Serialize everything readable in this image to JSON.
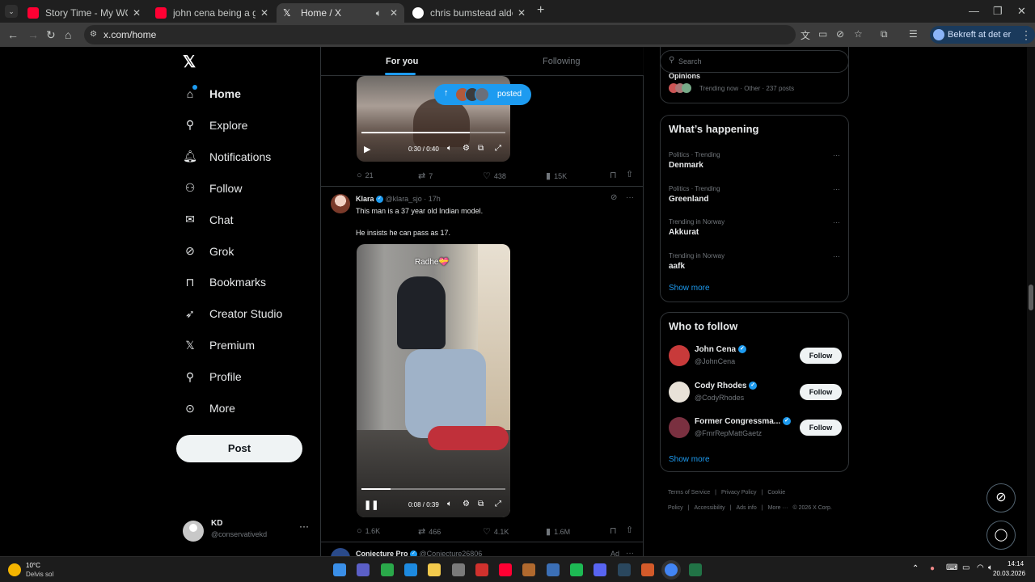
{
  "browser": {
    "tabs": [
      {
        "title": "Story Time - My WORST CYCLE",
        "favicon_color": "#ff0033"
      },
      {
        "title": "john cena being a girl - YouTube",
        "favicon_color": "#ff0033"
      },
      {
        "title": "Home / X",
        "favicon_color": "#ffffff",
        "active": true
      },
      {
        "title": "chris bumstead alder - Google",
        "favicon_color": "#4285f4"
      }
    ],
    "url": "x.com/home",
    "profile_chip": "Bekreft at det er deg"
  },
  "sidebar": {
    "items": [
      {
        "label": "Home",
        "icon": "home-icon"
      },
      {
        "label": "Explore",
        "icon": "search-icon"
      },
      {
        "label": "Notifications",
        "icon": "bell-icon"
      },
      {
        "label": "Follow",
        "icon": "person-add-icon"
      },
      {
        "label": "Chat",
        "icon": "mail-icon"
      },
      {
        "label": "Grok",
        "icon": "grok-icon"
      },
      {
        "label": "Bookmarks",
        "icon": "bookmark-icon"
      },
      {
        "label": "Creator Studio",
        "icon": "rocket-icon"
      },
      {
        "label": "Premium",
        "icon": "x-logo-icon"
      },
      {
        "label": "Profile",
        "icon": "person-icon"
      },
      {
        "label": "More",
        "icon": "more-circle-icon"
      }
    ],
    "post_label": "Post",
    "account": {
      "name": "KD",
      "handle": "@conservativekd"
    }
  },
  "feed": {
    "tabs": [
      "For you",
      "Following"
    ],
    "new_posts_pill": "posted",
    "post1": {
      "video_time": "0:30 / 0:40",
      "video_progress": 0.75,
      "replies": "21",
      "reposts": "7",
      "likes": "438",
      "views": "15K"
    },
    "post2": {
      "author": "Klara",
      "handle": "@klara_sjo",
      "time": "17h",
      "text1": "This man is a 37 year old Indian model.",
      "text2": "He insists he can pass as 17.",
      "video_caption": "Radhe💝",
      "video_time": "0:08 / 0:39",
      "video_progress": 0.2,
      "replies": "1.6K",
      "reposts": "466",
      "likes": "4.1K",
      "views": "1.6M"
    },
    "post3": {
      "author": "Conjecture Pro",
      "handle": "@Conjecture26806",
      "ad": "Ad"
    }
  },
  "right": {
    "search_placeholder": "Search",
    "top_trend": {
      "name": "Opinions",
      "meta": "Trending now · Other · 237 posts"
    },
    "whats_happening": {
      "title": "What’s happening",
      "trends": [
        {
          "category": "Politics · Trending",
          "name": "Denmark"
        },
        {
          "category": "Politics · Trending",
          "name": "Greenland"
        },
        {
          "category": "Trending in Norway",
          "name": "Akkurat"
        },
        {
          "category": "Trending in Norway",
          "name": "aafk"
        }
      ],
      "show_more": "Show more"
    },
    "who_to_follow": {
      "title": "Who to follow",
      "users": [
        {
          "name": "John Cena",
          "handle": "@JohnCena"
        },
        {
          "name": "Cody Rhodes",
          "handle": "@CodyRhodes"
        },
        {
          "name": "Former Congressma...",
          "handle": "@FmrRepMattGaetz"
        }
      ],
      "follow_label": "Follow",
      "show_more": "Show more"
    },
    "footer": [
      "Terms of Service",
      "|",
      "Privacy Policy",
      "|",
      "Cookie Policy",
      "|",
      "Accessibility",
      "|",
      "Ads info",
      "|",
      "More ···",
      "© 2026 X Corp."
    ]
  },
  "taskbar": {
    "weather_temp": "10°C",
    "weather_desc": "Delvis sol",
    "time": "14:14",
    "date": "20.03.2026"
  },
  "colors": {
    "accent": "#1d9bf0",
    "verified": "#1d9bf0",
    "bg": "#000000",
    "border": "#2f3336",
    "muted": "#71767b"
  }
}
